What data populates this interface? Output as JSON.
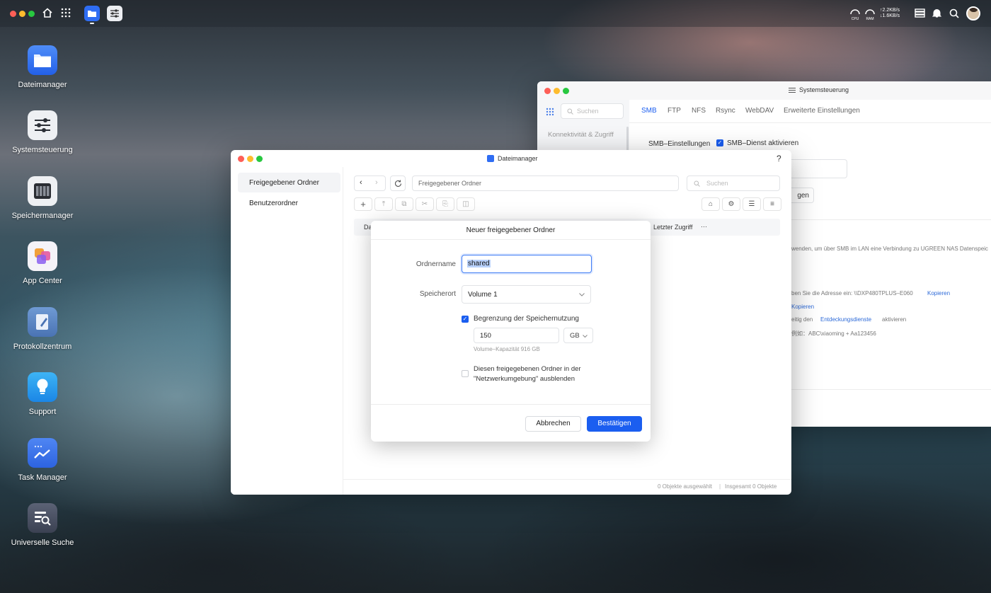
{
  "topbar": {
    "cpu_label": "CPU",
    "ram_label": "RAM",
    "upload": "↑2.2KB/s",
    "download": "↓1.6KB/s"
  },
  "desktop": {
    "apps": [
      {
        "label": "Dateimanager",
        "icon": "folder-icon"
      },
      {
        "label": "Systemsteuerung",
        "icon": "sliders-icon"
      },
      {
        "label": "Speichermanager",
        "icon": "storage-icon"
      },
      {
        "label": "App Center",
        "icon": "app-center-icon"
      },
      {
        "label": "Protokollzentrum",
        "icon": "log-icon"
      },
      {
        "label": "Support",
        "icon": "lightbulb-icon"
      },
      {
        "label": "Task Manager",
        "icon": "chart-icon"
      },
      {
        "label": "Universelle Suche",
        "icon": "search-list-icon"
      }
    ]
  },
  "system_window": {
    "title": "Systemsteuerung",
    "search_placeholder": "Suchen",
    "sidebar_item": "Konnektivität & Zugriff",
    "tabs": [
      "SMB",
      "FTP",
      "NFS",
      "Rsync",
      "WebDAV",
      "Erweiterte Einstellungen"
    ],
    "smb_settings_label": "SMB–Einstellungen",
    "smb_enable": "SMB–Dienst aktivieren",
    "button_partial": "gen",
    "info_line1": "wenden, um über SMB im LAN eine Verbindung zu UGREEN NAS Datenspeic",
    "info_line2": "ben Sie die Adresse ein: \\\\DXP480TPLUS–E060",
    "copy1": "Kopieren",
    "copy2": "Kopieren",
    "info_line4_prefix": "eitig den",
    "discovery_link": "Entdeckungsdienste",
    "info_line4_suffix": "aktivieren",
    "info_line5": "例如：ABC\\xiaoming + Aa123456"
  },
  "file_window": {
    "title": "Dateimanager",
    "help": "?",
    "sidebar": [
      "Freigegebener Ordner",
      "Benutzerordner"
    ],
    "path": "Freigegebener Ordner",
    "search_placeholder": "Suchen",
    "col_name_partial": "Da",
    "col_last_access": "Letzter Zugriff",
    "col_more": "···",
    "status_selected": "0 Objekte ausgewählt",
    "status_sep": "|",
    "status_total": "Insgesamt 0 Objekte"
  },
  "dialog": {
    "title": "Neuer freigegebener Ordner",
    "name_label": "Ordnername",
    "name_value": "shared",
    "location_label": "Speicherort",
    "location_value": "Volume 1",
    "quota_checkbox": "Begrenzung der Speichernutzung",
    "quota_value": "150",
    "quota_unit": "GB",
    "capacity_hint": "Volume–Kapazität 916 GB",
    "hide_checkbox_line1": "Diesen freigegebenen Ordner in der",
    "hide_checkbox_line2": "\"Netzwerkumgebung\" ausblenden",
    "cancel": "Abbrechen",
    "confirm": "Bestätigen"
  },
  "colors": {
    "accent": "#1b5ef0",
    "link": "#2d6ad8"
  }
}
